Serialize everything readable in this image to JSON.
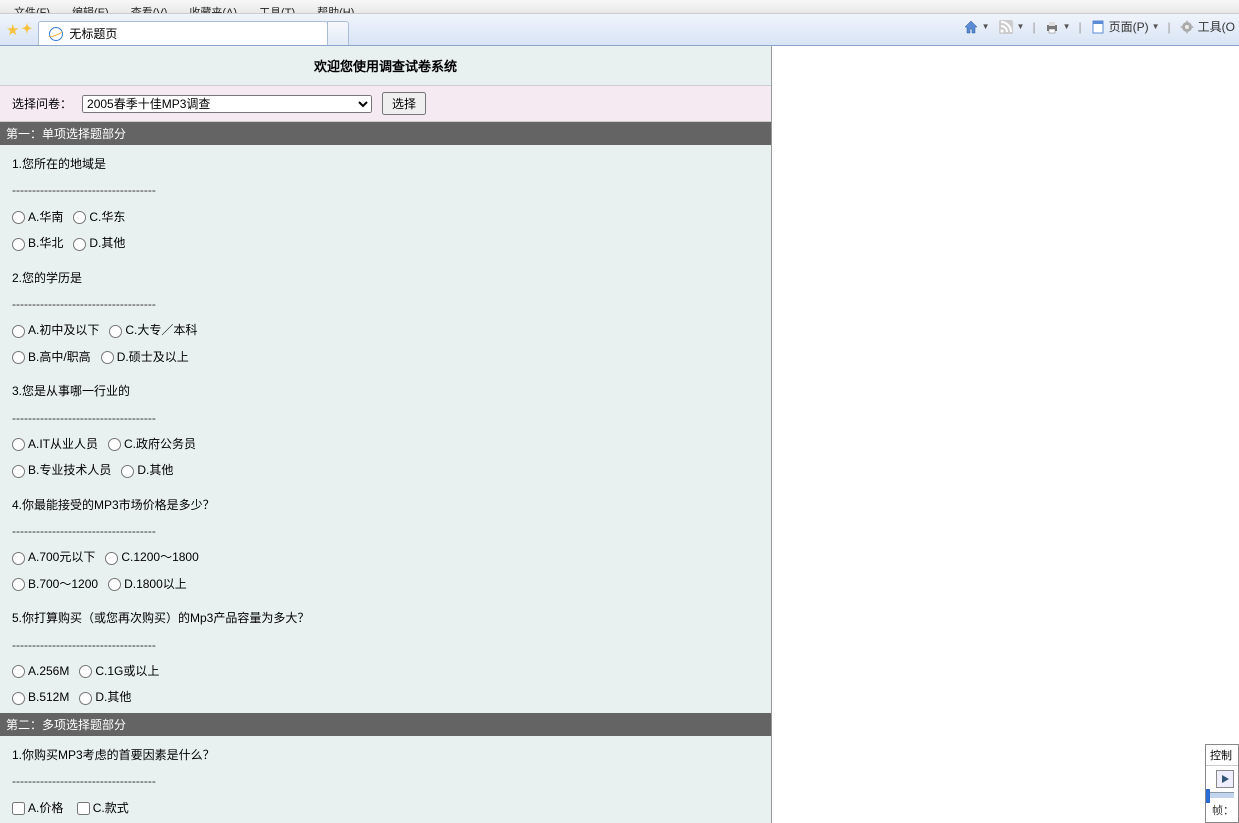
{
  "menubar": [
    "文件(F)",
    "编辑(E)",
    "查看(V)",
    "收藏夹(A)",
    "工具(T)",
    "帮助(H)"
  ],
  "tab_title": "无标题页",
  "right_tools": {
    "page": "页面(P)",
    "tools": "工具(O"
  },
  "page_heading": "欢迎您使用调查试卷系统",
  "selector_label": "选择问卷：",
  "selector_value": "2005春季十佳MP3调查",
  "select_button": "选择",
  "section1": "第一：单项选择题部分",
  "section2": "第二：多项选择题部分",
  "divider": "------------------------------------",
  "questions": [
    {
      "q": "1.您所在的地域是",
      "opts": [
        [
          "A.华南",
          "C.华东"
        ],
        [
          "B.华北",
          "D.其他"
        ]
      ]
    },
    {
      "q": "2.您的学历是",
      "opts": [
        [
          "A.初中及以下",
          "C.大专／本科"
        ],
        [
          "B.高中/职高",
          "D.硕士及以上"
        ]
      ]
    },
    {
      "q": "3.您是从事哪一行业的",
      "opts": [
        [
          "A.IT从业人员",
          "C.政府公务员"
        ],
        [
          "B.专业技术人员",
          "D.其他"
        ]
      ]
    },
    {
      "q": "4.你最能接受的MP3市场价格是多少？",
      "opts": [
        [
          "A.700元以下",
          "C.1200～1800"
        ],
        [
          "B.700～1200",
          "D.1800以上"
        ]
      ]
    },
    {
      "q": "5.你打算购买（或您再次购买）的Mp3产品容量为多大？",
      "opts": [
        [
          "A.256M",
          "C.1G或以上"
        ],
        [
          "B.512M",
          "D.其他"
        ]
      ]
    }
  ],
  "mq1": "1.你购买MP3考虑的首要因素是什么？",
  "mq1_opts": [
    "A.价格",
    "C.款式"
  ],
  "debug": {
    "title": "控制",
    "frame": "帧："
  }
}
